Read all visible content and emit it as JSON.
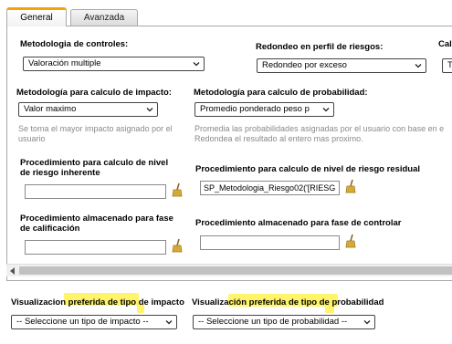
{
  "tabs": [
    {
      "label": "General",
      "active": true
    },
    {
      "label": "Avanzada",
      "active": false
    }
  ],
  "metodologia_controles": {
    "label": "Metodologia de controles:",
    "value": "Valoración multiple"
  },
  "redondeo": {
    "label": "Redondeo en perfil de riesgos:",
    "value": "Redondeo por exceso"
  },
  "calc_cut": {
    "label": "Calc",
    "value": "T"
  },
  "impacto": {
    "label": "Metodología para calculo de impacto:",
    "value": "Valor maximo",
    "hint_line1": "Se toma el mayor impacto asignado por el",
    "hint_line2": "usuario"
  },
  "probabilidad": {
    "label": "Metodología para calculo de probabilidad:",
    "value": "Promedio ponderado peso p",
    "hint_line1": "Promedia las probabilidades asignadas por el usuario con base en e",
    "hint_line2": "Redondea el resultado al entero mas proximo."
  },
  "proc_inherente": {
    "label": "Procedimiento para calculo de nivel de riesgo inherente",
    "value": ""
  },
  "proc_residual": {
    "label": "Procedimiento para calculo de nivel de riesgo residual",
    "value": "SP_Metodologia_Riesgo02('[RIESG"
  },
  "proc_calificacion": {
    "label": "Procedimiento almacenado para fase de calificación",
    "value": ""
  },
  "proc_controlar": {
    "label": "Procedimiento almacenado para fase de controlar",
    "value": ""
  },
  "vis_impacto": {
    "label": "Visualizacion preferida de tipo de impacto",
    "value": "-- Seleccione un tipo de impacto --"
  },
  "vis_probabilidad": {
    "label": "Visualización preferida de tipo de probabilidad",
    "value": "-- Seleccione un tipo de probabilidad --"
  },
  "colors": {
    "tab_accent": "#f4a400",
    "highlight": "#fff46a",
    "hint_text": "#8a8a8a"
  }
}
